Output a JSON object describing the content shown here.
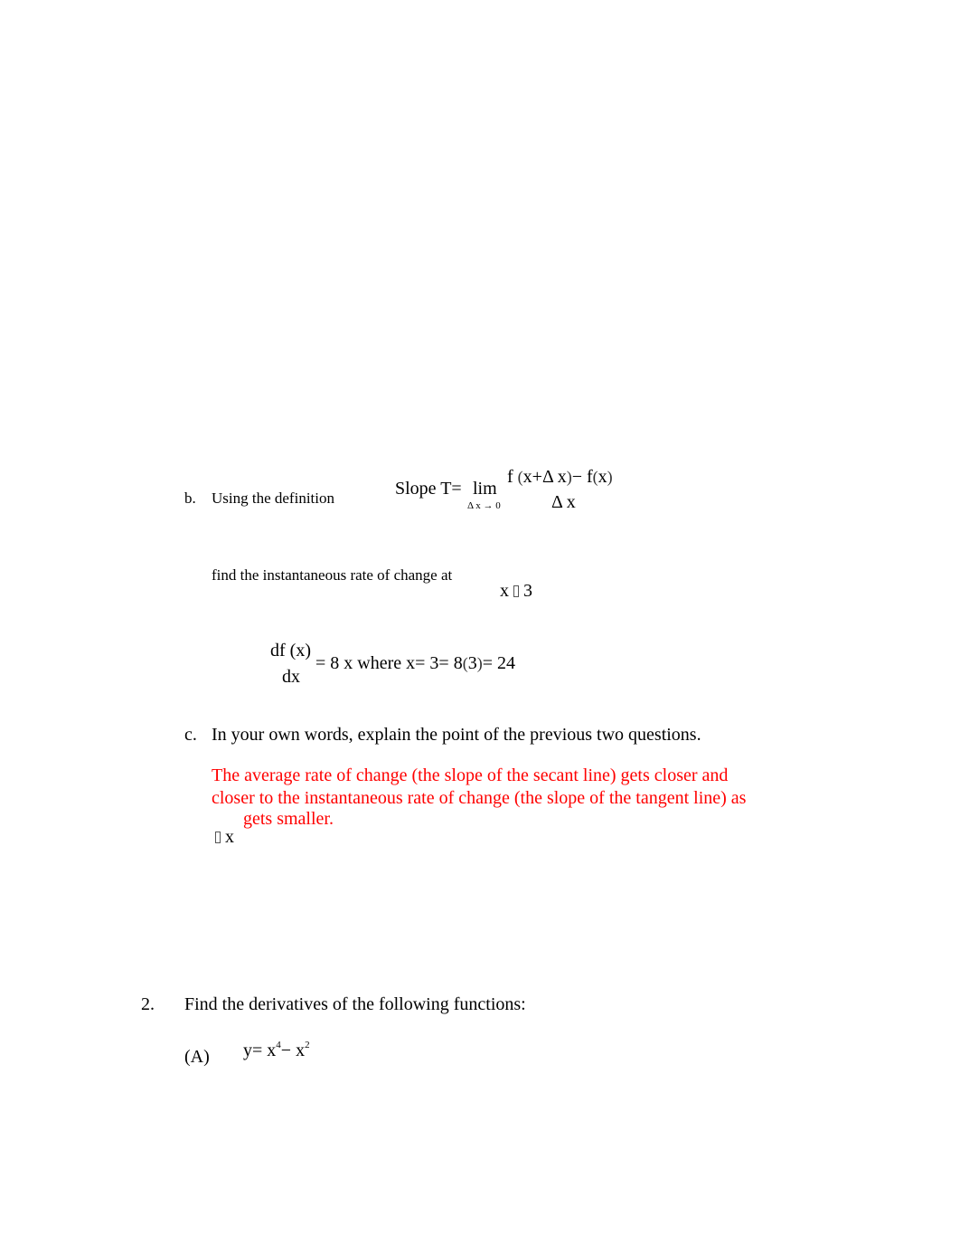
{
  "colors": {
    "text": "#000000",
    "answer": "#ff0000",
    "background": "#ffffff"
  },
  "part_b": {
    "label": "b.",
    "intro": "Using the definition",
    "formula": {
      "lhs": "Slope T=",
      "lim": "lim",
      "lim_sub": "Δ x → 0",
      "numerator": {
        "f1": "f",
        "open1": "(",
        "arg1": "x+Δ x",
        "close1": ")",
        "minus": "−",
        "f2": "f",
        "open2": "(",
        "arg2": "x",
        "close2": ")"
      },
      "denominator": "Δ x"
    },
    "prompt": "find the instantaneous rate of change at",
    "condition": {
      "var": "x",
      "value": "3"
    },
    "answer": {
      "numerator": "df (x)",
      "denominator": "dx",
      "rest_a": "= 8 x where x=",
      "rest_b": "3= 8",
      "open": "(",
      "three": "3",
      "close": ")",
      "result": "= 24"
    }
  },
  "part_c": {
    "label": "c.",
    "question": "In your own words, explain the point of the previous two questions.",
    "answer_line1": "The average rate of change (the slope of the secant line) gets closer and",
    "answer_line2": "closer to the instantaneous rate of change (the slope of the tangent line) as",
    "answer_line3": "gets smaller.",
    "delta_var": "x"
  },
  "question_2": {
    "number": "2.",
    "prompt": "Find the derivatives of the following functions:",
    "items": [
      {
        "label": "(A)",
        "lhs": "y=",
        "term1_base": "x",
        "term1_exp": "4",
        "op": "−",
        "term2_base": "x",
        "term2_exp": "2"
      }
    ]
  }
}
